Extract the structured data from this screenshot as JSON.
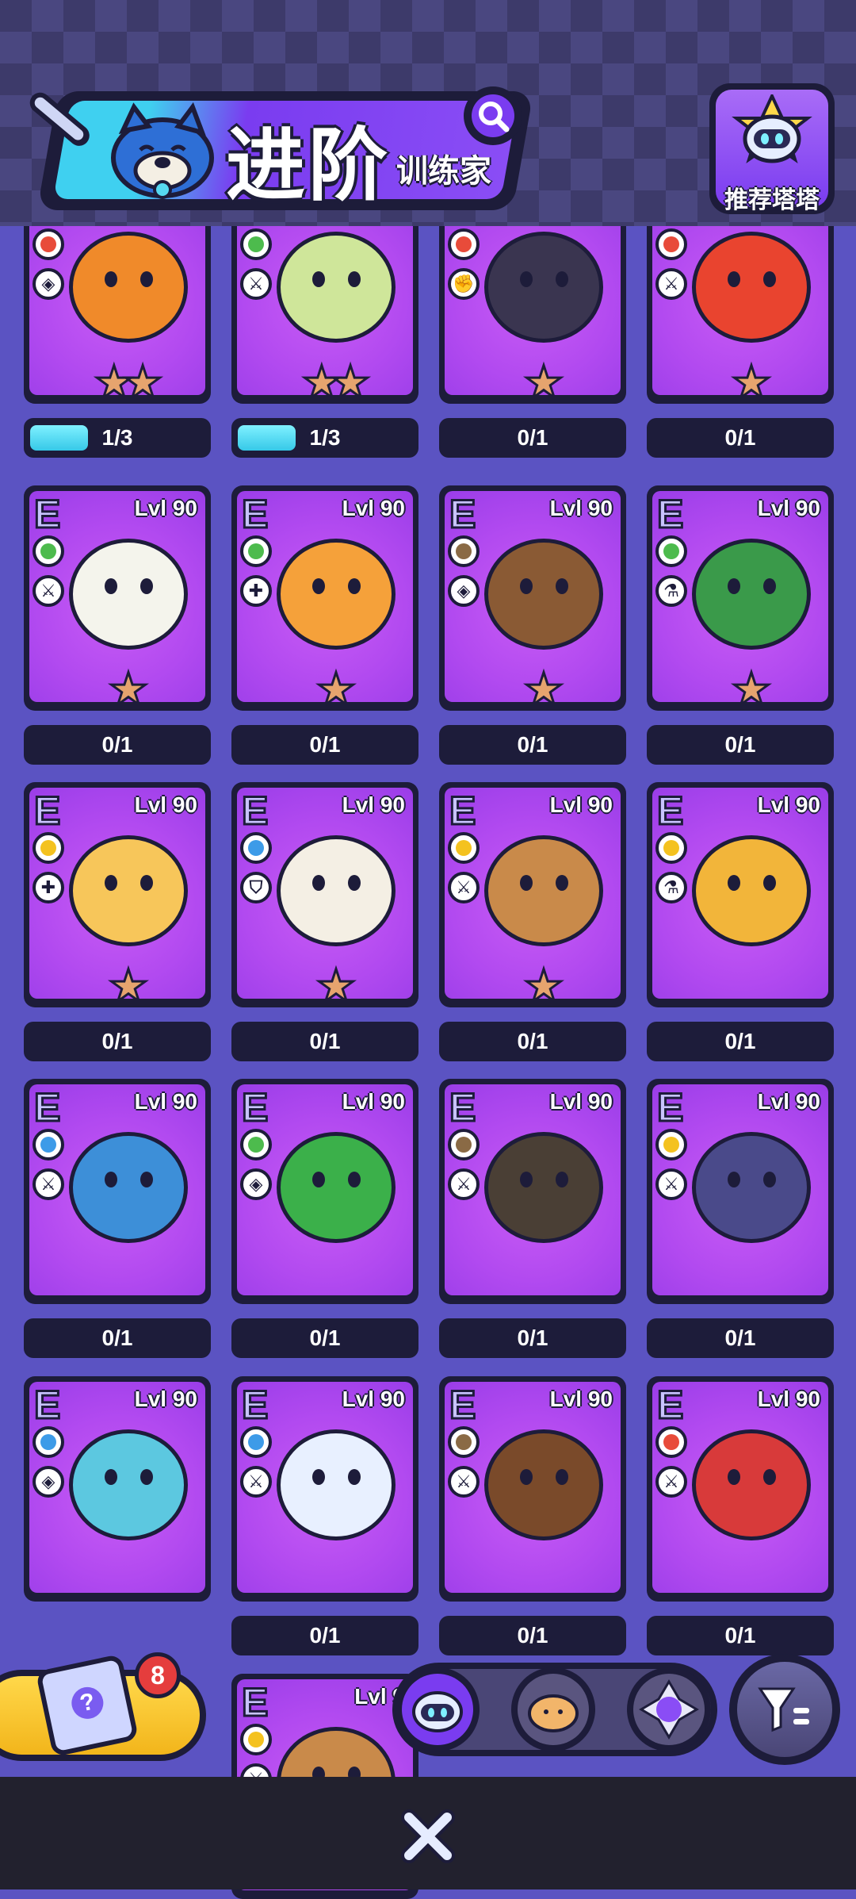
{
  "header": {
    "title": "进阶",
    "subtitle": "训练家",
    "recommend_label": "推荐塔塔"
  },
  "colors": {
    "fire": "#e84b3a",
    "grass": "#4dbb4d",
    "earth": "#8a6a45",
    "electric": "#f4c21f",
    "water": "#3d9be8",
    "card_purple": "#b24af0",
    "progress_cyan": "#36c9e8",
    "frame_dark": "#1d1c3a"
  },
  "cards": [
    {
      "rarity": "E",
      "level": "Lvl 90",
      "element": "fire",
      "role": "diamond",
      "stars": "★★",
      "progress": "1/3",
      "progress_fraction": 0.33,
      "color": "#f08a2a"
    },
    {
      "rarity": "E",
      "level": "Lvl 90",
      "element": "grass",
      "role": "sword",
      "stars": "★★",
      "progress": "1/3",
      "progress_fraction": 0.33,
      "color": "#cfe69a"
    },
    {
      "rarity": "E",
      "level": "Lvl 90",
      "element": "fire",
      "role": "fist",
      "stars": "★",
      "progress": "0/1",
      "progress_fraction": 0,
      "color": "#3a3550"
    },
    {
      "rarity": "E",
      "level": "Lvl 90",
      "element": "fire",
      "role": "sword",
      "stars": "★",
      "progress": "0/1",
      "progress_fraction": 0,
      "color": "#e9442f"
    },
    {
      "rarity": "E",
      "level": "Lvl 90",
      "element": "grass",
      "role": "sword",
      "stars": "★",
      "progress": "0/1",
      "progress_fraction": 0,
      "color": "#f4f4ec"
    },
    {
      "rarity": "E",
      "level": "Lvl 90",
      "element": "grass",
      "role": "cross",
      "stars": "★",
      "progress": "0/1",
      "progress_fraction": 0,
      "color": "#f5a13a"
    },
    {
      "rarity": "E",
      "level": "Lvl 90",
      "element": "earth",
      "role": "diamond",
      "stars": "★",
      "progress": "0/1",
      "progress_fraction": 0,
      "color": "#8a5a34"
    },
    {
      "rarity": "E",
      "level": "Lvl 90",
      "element": "grass",
      "role": "flask",
      "stars": "★",
      "progress": "0/1",
      "progress_fraction": 0,
      "color": "#3a9a4a"
    },
    {
      "rarity": "E",
      "level": "Lvl 90",
      "element": "electric",
      "role": "cross",
      "stars": "★",
      "progress": "0/1",
      "progress_fraction": 0,
      "color": "#f7c65a"
    },
    {
      "rarity": "E",
      "level": "Lvl 90",
      "element": "water",
      "role": "shield",
      "stars": "★",
      "progress": "0/1",
      "progress_fraction": 0,
      "color": "#f4efe4"
    },
    {
      "rarity": "E",
      "level": "Lvl 90",
      "element": "electric",
      "role": "sword",
      "stars": "★",
      "progress": "0/1",
      "progress_fraction": 0,
      "color": "#c98a4a"
    },
    {
      "rarity": "E",
      "level": "Lvl 90",
      "element": "electric",
      "role": "flask",
      "stars": "",
      "progress": "0/1",
      "progress_fraction": 0,
      "color": "#f2b53a"
    },
    {
      "rarity": "E",
      "level": "Lvl 90",
      "element": "water",
      "role": "sword",
      "stars": "",
      "progress": "0/1",
      "progress_fraction": 0,
      "color": "#3d8fd8"
    },
    {
      "rarity": "E",
      "level": "Lvl 90",
      "element": "grass",
      "role": "diamond",
      "stars": "",
      "progress": "0/1",
      "progress_fraction": 0,
      "color": "#3bb04a"
    },
    {
      "rarity": "E",
      "level": "Lvl 90",
      "element": "earth",
      "role": "sword",
      "stars": "",
      "progress": "0/1",
      "progress_fraction": 0,
      "color": "#4a3f35"
    },
    {
      "rarity": "E",
      "level": "Lvl 90",
      "element": "electric",
      "role": "sword",
      "stars": "",
      "progress": "0/1",
      "progress_fraction": 0,
      "color": "#4a4a8a"
    },
    {
      "rarity": "E",
      "level": "Lvl 90",
      "element": "water",
      "role": "diamond",
      "stars": "",
      "progress": "",
      "progress_fraction": 0,
      "color": "#5cc8e0"
    },
    {
      "rarity": "E",
      "level": "Lvl 90",
      "element": "water",
      "role": "sword",
      "stars": "",
      "progress": "0/1",
      "progress_fraction": 0,
      "color": "#e8f0ff"
    },
    {
      "rarity": "E",
      "level": "Lvl 90",
      "element": "earth",
      "role": "sword",
      "stars": "",
      "progress": "0/1",
      "progress_fraction": 0,
      "color": "#7a4a2a"
    },
    {
      "rarity": "E",
      "level": "Lvl 90",
      "element": "fire",
      "role": "sword",
      "stars": "",
      "progress": "0/1",
      "progress_fraction": 0,
      "color": "#d83a3a"
    },
    {
      "rarity": "E",
      "level": "Lvl 9",
      "element": "electric",
      "role": "sword",
      "stars": "",
      "progress": "",
      "progress_fraction": 0,
      "color": "#c98a4a"
    }
  ],
  "gift": {
    "badge_count": "8"
  },
  "tabs": [
    {
      "name": "tab-robot",
      "selected": true,
      "color": "#e6eeff"
    },
    {
      "name": "tab-hamster",
      "selected": false,
      "color": "#f2b56a"
    },
    {
      "name": "tab-crystal",
      "selected": false,
      "color": "#8a4df5"
    }
  ]
}
